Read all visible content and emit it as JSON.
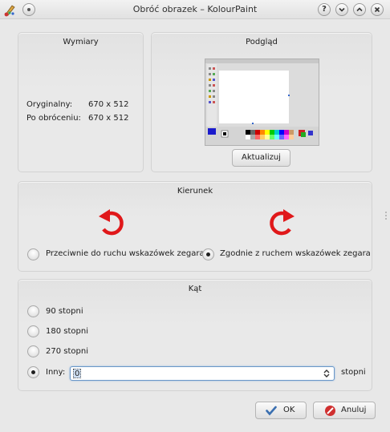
{
  "window": {
    "title": "Obróć obrazek – KolourPaint",
    "help_glyph": "?",
    "minimize_glyph": "⌄",
    "maximize_glyph": "⌃",
    "close_glyph": "✕"
  },
  "dimensions": {
    "title": "Wymiary",
    "original_label": "Oryginalny:",
    "original_value": "670 x 512",
    "after_label": "Po obróceniu:",
    "after_value": "670 x 512"
  },
  "preview": {
    "title": "Podgląd",
    "update_button": "Aktualizuj"
  },
  "direction": {
    "title": "Kierunek",
    "ccw_label": "Przeciwnie do ruchu wskazówek zegara",
    "cw_label": "Zgodnie z ruchem wskazówek zegara",
    "selected": "cw",
    "arrow_color": "#e0181a"
  },
  "angle": {
    "title": "Kąt",
    "options": [
      "90 stopni",
      "180 stopni",
      "270 stopni"
    ],
    "other_label": "Inny:",
    "other_value": "0",
    "unit": "stopni",
    "selected": "other"
  },
  "footer": {
    "ok_label": "OK",
    "cancel_label": "Anuluj"
  },
  "colors": {
    "accent": "#6a97c8",
    "cancel_icon": "#d03030",
    "ok_icon": "#3a6fb0"
  }
}
